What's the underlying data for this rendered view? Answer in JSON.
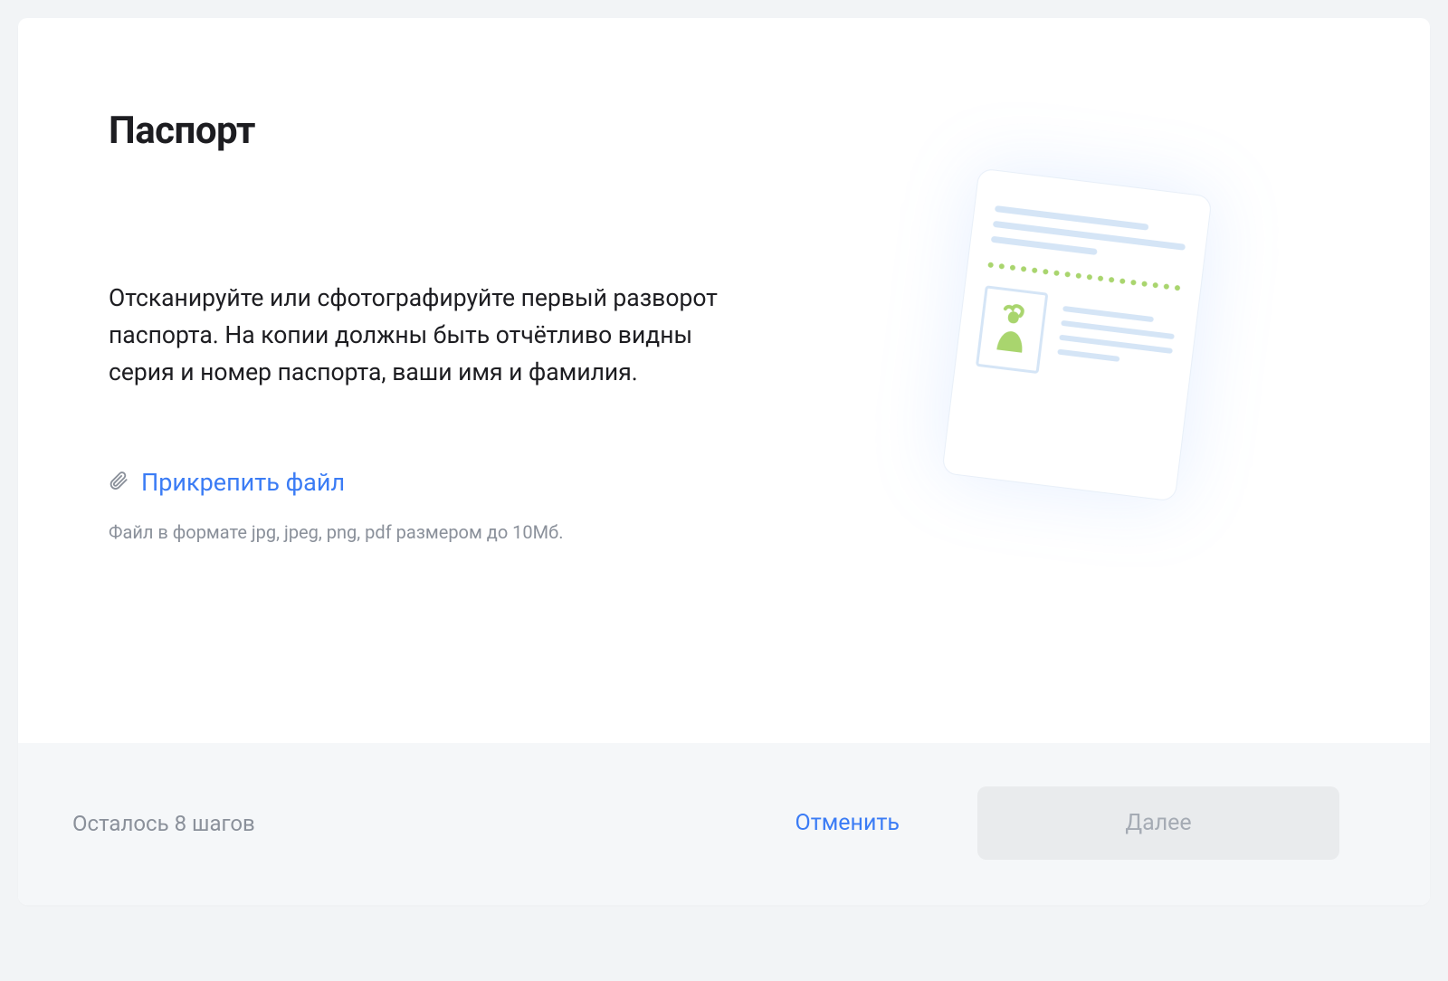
{
  "header": {
    "title": "Паспорт"
  },
  "instructions": {
    "description": "Отсканируйте или сфотографируйте первый разворот паспорта. На копии должны быть отчётливо видны серия и номер паспорта, ваши имя и фамилия."
  },
  "upload": {
    "attach_label": "Прикрепить файл",
    "hint": "Файл в формате jpg, jpeg, png, pdf размером до 10Мб."
  },
  "footer": {
    "steps_left": "Осталось 8 шагов",
    "cancel_label": "Отменить",
    "next_label": "Далее"
  },
  "illustration": {
    "name": "passport-document-illustration"
  },
  "colors": {
    "link": "#3b7cf5",
    "muted": "#8a909a",
    "green": "#a9d56e",
    "line_blue": "#d5e5f6"
  }
}
